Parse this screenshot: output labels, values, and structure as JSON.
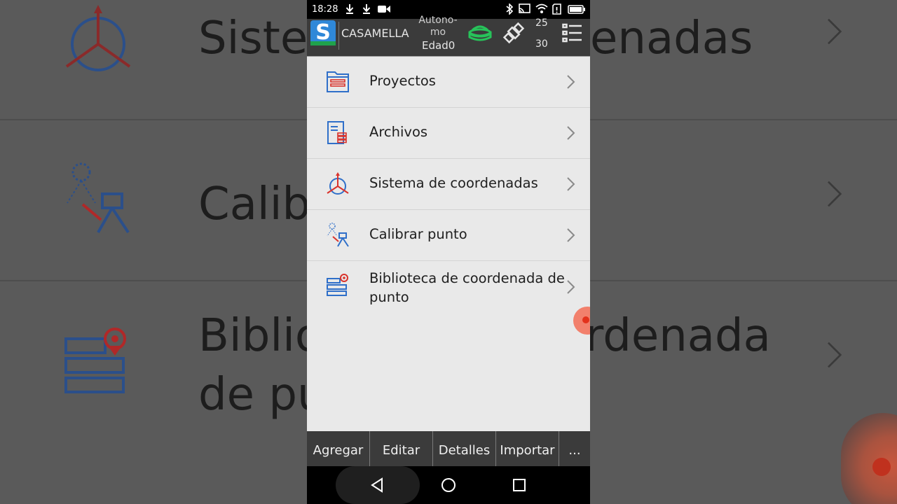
{
  "background": {
    "rows": [
      {
        "text": "Siste",
        "text2": "enadas"
      },
      {
        "text": "Calib"
      },
      {
        "text": "Biblio",
        "text2": "rdenada",
        "text3": "de pu"
      }
    ]
  },
  "status_bar": {
    "time": "18:28",
    "icons": [
      "download-icon",
      "download-icon",
      "video-camera-icon",
      "bluetooth-icon",
      "cast-icon",
      "wifi-icon",
      "sim-alert-icon",
      "battery-icon"
    ]
  },
  "app_bar": {
    "project_name": "CASAMELLA",
    "mode": "Autono-\nmo",
    "age": "Edad0",
    "sat_used": "25",
    "sat_total": "30",
    "icons": [
      "logo-icon",
      "gnss-receiver-icon",
      "satellite-icon",
      "list-menu-icon"
    ]
  },
  "menu": {
    "items": [
      {
        "label": "Proyectos",
        "icon": "project-folder-icon"
      },
      {
        "label": "Archivos",
        "icon": "files-icon"
      },
      {
        "label": "Sistema de coordenadas",
        "icon": "coordinate-system-icon"
      },
      {
        "label": "Calibrar punto",
        "icon": "calibrate-point-icon"
      },
      {
        "label": "Biblioteca de coordenada de punto",
        "icon": "point-library-icon"
      }
    ]
  },
  "toolbar": {
    "buttons": [
      "Agregar",
      "Editar",
      "Detalles",
      "Importar",
      "..."
    ]
  },
  "colors": {
    "accent_red": "#d9322b",
    "accent_blue": "#2f6fc9",
    "bar_dark": "#3b3b3b",
    "list_bg": "#e9e9e9",
    "gnss_green": "#27c35a"
  }
}
